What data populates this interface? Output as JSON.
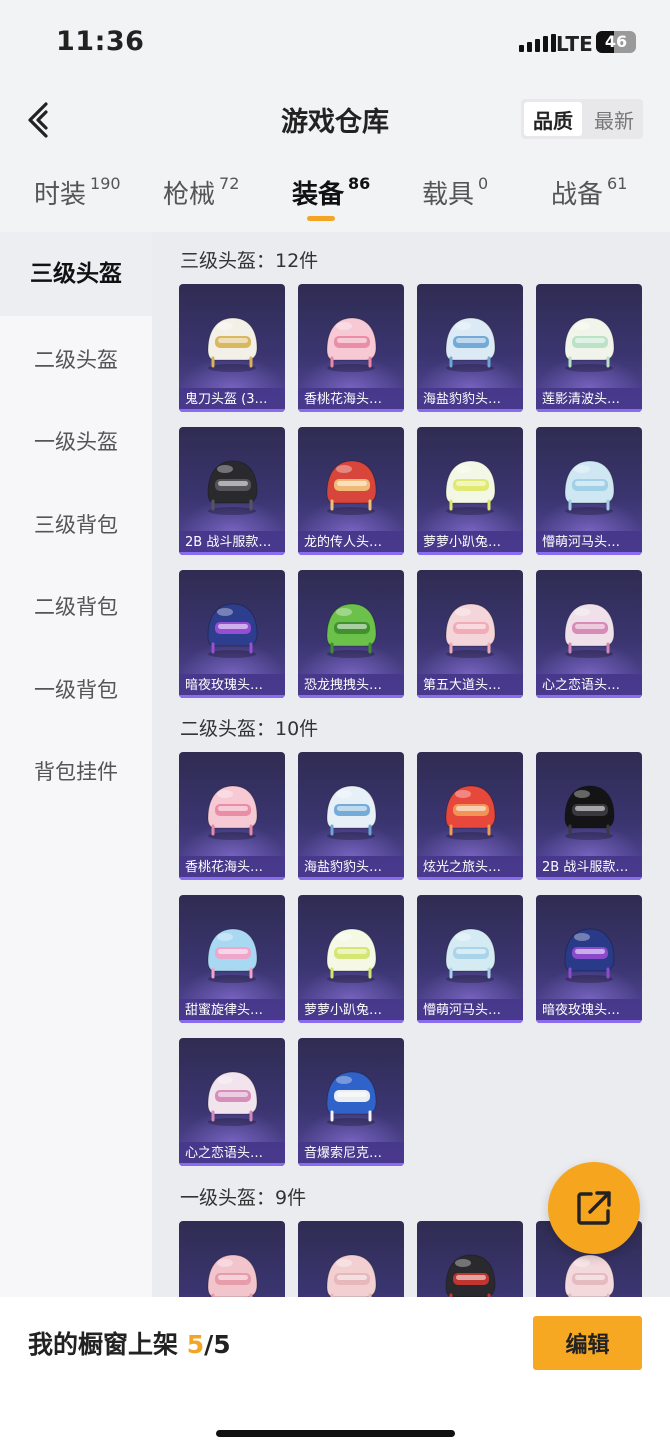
{
  "status": {
    "time": "11:36",
    "network": "LTE",
    "battery": "46",
    "battery_level": 0.46
  },
  "header": {
    "title": "游戏仓库",
    "sort": [
      "品质",
      "最新"
    ]
  },
  "tabs": [
    {
      "label": "时装",
      "count": "190"
    },
    {
      "label": "枪械",
      "count": "72"
    },
    {
      "label": "装备",
      "count": "86"
    },
    {
      "label": "载具",
      "count": "0"
    },
    {
      "label": "战备",
      "count": "61"
    }
  ],
  "sidebar": [
    "三级头盔",
    "二级头盔",
    "一级头盔",
    "三级背包",
    "二级背包",
    "一级背包",
    "背包挂件"
  ],
  "sections": [
    {
      "title": "三级头盔：12件",
      "items": [
        {
          "name": "鬼刀头盔 (3…",
          "colors": [
            "#f3f0e8",
            "#d8b35a"
          ]
        },
        {
          "name": "香桃花海头…",
          "colors": [
            "#f6c9d4",
            "#e98aa3"
          ]
        },
        {
          "name": "海盐豹豹头…",
          "colors": [
            "#dbeaf5",
            "#6fa6d6"
          ]
        },
        {
          "name": "莲影清波头…",
          "colors": [
            "#f1f4ea",
            "#b7e0c4"
          ]
        },
        {
          "name": "2B 战斗服款…",
          "colors": [
            "#2a2a2e",
            "#55555c"
          ]
        },
        {
          "name": "龙的传人头…",
          "colors": [
            "#d8463b",
            "#f0c079"
          ]
        },
        {
          "name": "萝萝小趴兔…",
          "colors": [
            "#f3f7e6",
            "#dfe86a"
          ]
        },
        {
          "name": "懵萌河马头…",
          "colors": [
            "#cfe7f2",
            "#9fcfe6"
          ]
        },
        {
          "name": "暗夜玫瑰头…",
          "colors": [
            "#2e3e8e",
            "#9a4fd6"
          ]
        },
        {
          "name": "恐龙拽拽头…",
          "colors": [
            "#6cc14a",
            "#3f8f2d"
          ]
        },
        {
          "name": "第五大道头…",
          "colors": [
            "#f4d5d9",
            "#f0aab5"
          ]
        },
        {
          "name": "心之恋语头…",
          "colors": [
            "#efe0ea",
            "#d487b4"
          ]
        }
      ]
    },
    {
      "title": "二级头盔：10件",
      "items": [
        {
          "name": "香桃花海头…",
          "colors": [
            "#f6c9d4",
            "#e98aa3"
          ]
        },
        {
          "name": "海盐豹豹头…",
          "colors": [
            "#e7f0f7",
            "#6fa6d6"
          ]
        },
        {
          "name": "炫光之旅头…",
          "colors": [
            "#e8483c",
            "#f09a56"
          ]
        },
        {
          "name": "2B 战斗服款…",
          "colors": [
            "#141416",
            "#3a3a40"
          ]
        },
        {
          "name": "甜蜜旋律头…",
          "colors": [
            "#a9d8f2",
            "#f1a3c8"
          ]
        },
        {
          "name": "萝萝小趴兔…",
          "colors": [
            "#f4f8e4",
            "#d3e56b"
          ]
        },
        {
          "name": "懵萌河马头…",
          "colors": [
            "#d5ebf4",
            "#a6d3e8"
          ]
        },
        {
          "name": "暗夜玫瑰头…",
          "colors": [
            "#283a88",
            "#8f4bd0"
          ]
        },
        {
          "name": "心之恋语头…",
          "colors": [
            "#f1e4ec",
            "#d48ab7"
          ]
        },
        {
          "name": "音爆索尼克…",
          "colors": [
            "#2f63c9",
            "#f4f4f4"
          ]
        }
      ]
    },
    {
      "title": "一级头盔：9件",
      "items": [
        {
          "name": "",
          "colors": [
            "#f2c4cc",
            "#e59aa8"
          ]
        },
        {
          "name": "",
          "colors": [
            "#f2d0d2",
            "#e6b6b9"
          ]
        },
        {
          "name": "",
          "colors": [
            "#2a2a2e",
            "#c7362f"
          ]
        },
        {
          "name": "",
          "colors": [
            "#f3d9dc",
            "#e4b9bf"
          ]
        }
      ]
    }
  ],
  "fab": {
    "icon": "share-icon"
  },
  "footer": {
    "label": "我的橱窗上架",
    "count": "5",
    "total": "/5",
    "edit": "编辑"
  }
}
